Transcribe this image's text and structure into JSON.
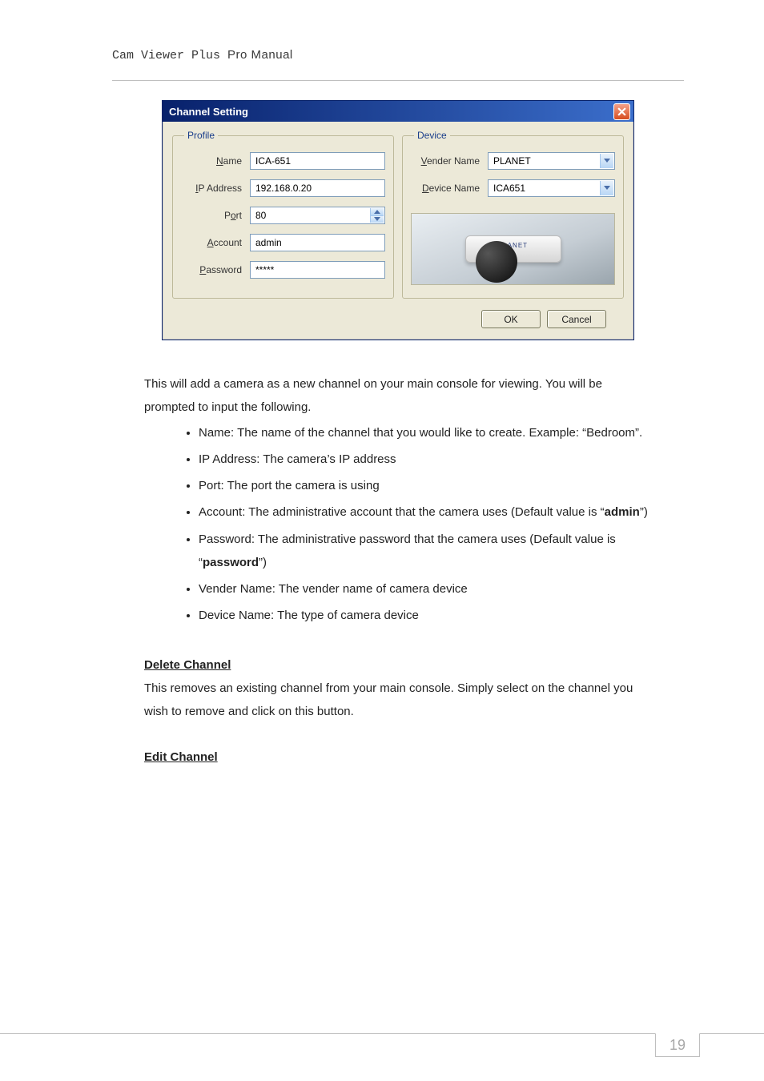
{
  "header": {
    "light": "Cam Viewer Plus ",
    "heavy": "Pro Manual"
  },
  "dialog": {
    "title": "Channel Setting",
    "profile_legend": "Profile",
    "device_legend": "Device",
    "labels": {
      "name_u": "N",
      "name_r": "ame",
      "ip_u": "I",
      "ip_r": "P Address",
      "port_pre": "P",
      "port_u": "o",
      "port_post": "rt",
      "acct_u": "A",
      "acct_r": "ccount",
      "pwd_u": "P",
      "pwd_r": "assword",
      "vendor_u": "V",
      "vendor_r": "ender Name",
      "devname_u": "D",
      "devname_r": "evice Name"
    },
    "values": {
      "name": "ICA-651",
      "ip": "192.168.0.20",
      "port": "80",
      "account": "admin",
      "password": "*****",
      "vendor": "PLANET",
      "devname": "ICA651",
      "brand": "PLANET"
    },
    "buttons": {
      "ok": "OK",
      "cancel": "Cancel"
    }
  },
  "body": {
    "intro": "This will add a camera as a new channel on your main console for viewing. You will be prompted to input the following.",
    "bullets": [
      {
        "t": "Name: The name of the channel that you would like to create. Example: “Bedroom”."
      },
      {
        "t": "IP Address: The camera’s IP address"
      },
      {
        "t": "Port: The port the camera is using"
      },
      {
        "pre": "Account: The administrative account that the camera uses (Default value is “",
        "bold": "admin",
        "post": "”)"
      },
      {
        "pre": "Password: The administrative password that the camera uses (Default value is “",
        "bold": "password",
        "post": "”)"
      },
      {
        "t": "Vender Name: The vender name of camera device"
      },
      {
        "t": "Device Name: The type of camera device"
      }
    ],
    "delete_head": "Delete Channel",
    "delete_text": "This removes an existing channel from your main console. Simply select on the channel you wish to remove and click on this button.",
    "edit_head": "Edit Channel"
  },
  "page_number": "19"
}
